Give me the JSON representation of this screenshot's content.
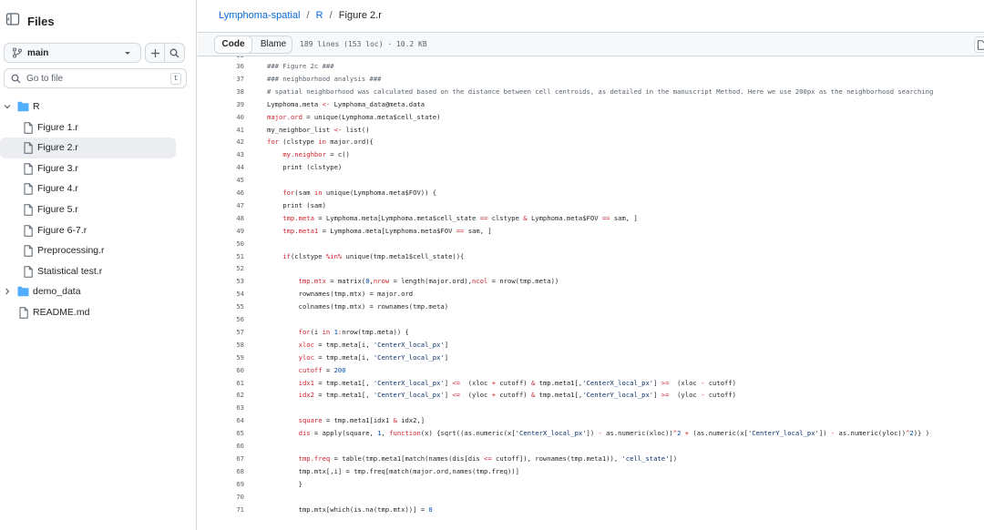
{
  "sidebar": {
    "title": "Files",
    "branch": "main",
    "search_placeholder": "Go to file",
    "search_shortcut": "t",
    "tree": [
      {
        "name": "R",
        "type": "folder",
        "open": true,
        "depth": 0
      },
      {
        "name": "Figure 1.r",
        "type": "file",
        "depth": 1
      },
      {
        "name": "Figure 2.r",
        "type": "file",
        "depth": 1,
        "selected": true
      },
      {
        "name": "Figure 3.r",
        "type": "file",
        "depth": 1
      },
      {
        "name": "Figure 4.r",
        "type": "file",
        "depth": 1
      },
      {
        "name": "Figure 5.r",
        "type": "file",
        "depth": 1
      },
      {
        "name": "Figure 6-7.r",
        "type": "file",
        "depth": 1
      },
      {
        "name": "Preprocessing.r",
        "type": "file",
        "depth": 1
      },
      {
        "name": "Statistical test.r",
        "type": "file",
        "depth": 1
      },
      {
        "name": "demo_data",
        "type": "folder",
        "open": false,
        "depth": 0
      },
      {
        "name": "README.md",
        "type": "file",
        "depth": 0
      }
    ]
  },
  "breadcrumb": {
    "repo": "Lymphoma-spatial",
    "sep1": "/",
    "folder": "R",
    "sep2": "/",
    "file": "Figure 2.r"
  },
  "filebar": {
    "code_tab": "Code",
    "blame_tab": "Blame",
    "info": "189 lines (153 loc) · 10.2 KB"
  },
  "colors": {
    "link": "#0969da",
    "keyword": "#cf222e",
    "string": "#0a3069",
    "number": "#0550ae",
    "comment": "#59636e",
    "folder": "#54aeff"
  },
  "code": {
    "first_partial_line": "35",
    "lines": [
      {
        "n": "36",
        "t": [
          [
            "c",
            "### Figure 2c ###"
          ]
        ]
      },
      {
        "n": "37",
        "t": [
          [
            "c",
            "### neighborhood analysis ###"
          ]
        ]
      },
      {
        "n": "38",
        "t": [
          [
            "c",
            "# spatial neighborhood was calculated based on the distance between cell centroids, as detailed in the manuscript Method. Here we use 200px as the neighborhood searching"
          ]
        ]
      },
      {
        "n": "39",
        "t": [
          [
            "p",
            "Lymphoma.meta "
          ],
          [
            "k",
            "<-"
          ],
          [
            "p",
            " Lymphoma_data@meta.data"
          ]
        ]
      },
      {
        "n": "40",
        "t": [
          [
            "k",
            "major.ord"
          ],
          [
            "p",
            " = unique(Lymphoma.meta$cell_state)"
          ]
        ]
      },
      {
        "n": "41",
        "t": [
          [
            "p",
            "my_neighbor_list "
          ],
          [
            "k",
            "<-"
          ],
          [
            "p",
            " list()"
          ]
        ]
      },
      {
        "n": "42",
        "t": [
          [
            "k",
            "for"
          ],
          [
            "p",
            " (clstype "
          ],
          [
            "k",
            "in"
          ],
          [
            "p",
            " major.ord){"
          ]
        ]
      },
      {
        "n": "43",
        "t": [
          [
            "p",
            "    "
          ],
          [
            "k",
            "my.neighbor"
          ],
          [
            "p",
            " = c()"
          ]
        ]
      },
      {
        "n": "44",
        "t": [
          [
            "p",
            "    print (clstype)"
          ]
        ]
      },
      {
        "n": "45",
        "t": [
          [
            "p",
            ""
          ]
        ]
      },
      {
        "n": "46",
        "t": [
          [
            "p",
            "    "
          ],
          [
            "k",
            "for"
          ],
          [
            "p",
            "(sam "
          ],
          [
            "k",
            "in"
          ],
          [
            "p",
            " unique(Lymphoma.meta$FOV)) {"
          ]
        ]
      },
      {
        "n": "47",
        "t": [
          [
            "p",
            "    print (sam)"
          ]
        ]
      },
      {
        "n": "48",
        "t": [
          [
            "p",
            "    "
          ],
          [
            "k",
            "tmp.meta"
          ],
          [
            "p",
            " = Lymphoma.meta[Lymphoma.meta$cell_state "
          ],
          [
            "k",
            "=="
          ],
          [
            "p",
            " clstype "
          ],
          [
            "k",
            "&"
          ],
          [
            "p",
            " Lymphoma.meta$FOV "
          ],
          [
            "k",
            "=="
          ],
          [
            "p",
            " sam, ]"
          ]
        ]
      },
      {
        "n": "49",
        "t": [
          [
            "p",
            "    "
          ],
          [
            "k",
            "tmp.meta1"
          ],
          [
            "p",
            " = Lymphoma.meta[Lymphoma.meta$FOV "
          ],
          [
            "k",
            "=="
          ],
          [
            "p",
            " sam, ]"
          ]
        ]
      },
      {
        "n": "50",
        "t": [
          [
            "p",
            ""
          ]
        ]
      },
      {
        "n": "51",
        "t": [
          [
            "p",
            "    "
          ],
          [
            "k",
            "if"
          ],
          [
            "p",
            "(clstype "
          ],
          [
            "k",
            "%in%"
          ],
          [
            "p",
            " unique(tmp.meta1$cell_state)){"
          ]
        ]
      },
      {
        "n": "52",
        "t": [
          [
            "p",
            ""
          ]
        ]
      },
      {
        "n": "53",
        "t": [
          [
            "p",
            "        "
          ],
          [
            "k",
            "tmp.mtx"
          ],
          [
            "p",
            " = matrix("
          ],
          [
            "n",
            "0"
          ],
          [
            "p",
            ","
          ],
          [
            "k",
            "nrow"
          ],
          [
            "p",
            " = length(major.ord),"
          ],
          [
            "k",
            "ncol"
          ],
          [
            "p",
            " = nrow(tmp.meta))"
          ]
        ]
      },
      {
        "n": "54",
        "t": [
          [
            "p",
            "        rownames(tmp.mtx) = major.ord"
          ]
        ]
      },
      {
        "n": "55",
        "t": [
          [
            "p",
            "        colnames(tmp.mtx) = rownames(tmp.meta)"
          ]
        ]
      },
      {
        "n": "56",
        "t": [
          [
            "p",
            ""
          ]
        ]
      },
      {
        "n": "57",
        "t": [
          [
            "p",
            "        "
          ],
          [
            "k",
            "for"
          ],
          [
            "p",
            "(i "
          ],
          [
            "k",
            "in"
          ],
          [
            "p",
            " "
          ],
          [
            "n",
            "1"
          ],
          [
            "k",
            ":"
          ],
          [
            "p",
            "nrow(tmp.meta)) {"
          ]
        ]
      },
      {
        "n": "58",
        "t": [
          [
            "p",
            "        "
          ],
          [
            "k",
            "xloc"
          ],
          [
            "p",
            " = tmp.meta[i, "
          ],
          [
            "s",
            "'CenterX_local_px'"
          ],
          [
            "p",
            "]"
          ]
        ]
      },
      {
        "n": "59",
        "t": [
          [
            "p",
            "        "
          ],
          [
            "k",
            "yloc"
          ],
          [
            "p",
            " = tmp.meta[i, "
          ],
          [
            "s",
            "'CenterY_local_px'"
          ],
          [
            "p",
            "]"
          ]
        ]
      },
      {
        "n": "60",
        "t": [
          [
            "p",
            "        "
          ],
          [
            "k",
            "cutoff"
          ],
          [
            "p",
            " = "
          ],
          [
            "n",
            "200"
          ]
        ]
      },
      {
        "n": "61",
        "t": [
          [
            "p",
            "        "
          ],
          [
            "k",
            "idx1"
          ],
          [
            "p",
            " = tmp.meta1[, "
          ],
          [
            "s",
            "'CenterX_local_px'"
          ],
          [
            "p",
            "] "
          ],
          [
            "k",
            "<="
          ],
          [
            "p",
            "  (xloc "
          ],
          [
            "k",
            "+"
          ],
          [
            "p",
            " cutoff) "
          ],
          [
            "k",
            "&"
          ],
          [
            "p",
            " tmp.meta1[,"
          ],
          [
            "s",
            "'CenterX_local_px'"
          ],
          [
            "p",
            "] "
          ],
          [
            "k",
            ">="
          ],
          [
            "p",
            "  (xloc "
          ],
          [
            "k",
            "-"
          ],
          [
            "p",
            " cutoff)"
          ]
        ]
      },
      {
        "n": "62",
        "t": [
          [
            "p",
            "        "
          ],
          [
            "k",
            "idx2"
          ],
          [
            "p",
            " = tmp.meta1[, "
          ],
          [
            "s",
            "'CenterY_local_px'"
          ],
          [
            "p",
            "] "
          ],
          [
            "k",
            "<="
          ],
          [
            "p",
            "  (yloc "
          ],
          [
            "k",
            "+"
          ],
          [
            "p",
            " cutoff) "
          ],
          [
            "k",
            "&"
          ],
          [
            "p",
            " tmp.meta1[,"
          ],
          [
            "s",
            "'CenterY_local_px'"
          ],
          [
            "p",
            "] "
          ],
          [
            "k",
            ">="
          ],
          [
            "p",
            "  (yloc "
          ],
          [
            "k",
            "-"
          ],
          [
            "p",
            " cutoff)"
          ]
        ]
      },
      {
        "n": "63",
        "t": [
          [
            "p",
            ""
          ]
        ]
      },
      {
        "n": "64",
        "t": [
          [
            "p",
            "        "
          ],
          [
            "k",
            "square"
          ],
          [
            "p",
            " = tmp.meta1[idx1 "
          ],
          [
            "k",
            "&"
          ],
          [
            "p",
            " idx2,]"
          ]
        ]
      },
      {
        "n": "65",
        "t": [
          [
            "p",
            "        "
          ],
          [
            "k",
            "dis"
          ],
          [
            "p",
            " = apply(square, "
          ],
          [
            "n",
            "1"
          ],
          [
            "p",
            ", "
          ],
          [
            "k",
            "function"
          ],
          [
            "p",
            "(x) {sqrt((as.numeric(x["
          ],
          [
            "s",
            "'CenterX_local_px'"
          ],
          [
            "p",
            "]) "
          ],
          [
            "k",
            "-"
          ],
          [
            "p",
            " as.numeric(xloc))"
          ],
          [
            "k",
            "^"
          ],
          [
            "n",
            "2"
          ],
          [
            "p",
            " "
          ],
          [
            "k",
            "+"
          ],
          [
            "p",
            " (as.numeric(x["
          ],
          [
            "s",
            "'CenterY_local_px'"
          ],
          [
            "p",
            "]) "
          ],
          [
            "k",
            "-"
          ],
          [
            "p",
            " as.numeric(yloc))"
          ],
          [
            "k",
            "^"
          ],
          [
            "n",
            "2"
          ],
          [
            "p",
            ")} )"
          ]
        ]
      },
      {
        "n": "66",
        "t": [
          [
            "p",
            ""
          ]
        ]
      },
      {
        "n": "67",
        "t": [
          [
            "p",
            "        "
          ],
          [
            "k",
            "tmp.freq"
          ],
          [
            "p",
            " = table(tmp.meta1[match(names(dis[dis "
          ],
          [
            "k",
            "<="
          ],
          [
            "p",
            " cutoff]), rownames(tmp.meta1)), "
          ],
          [
            "s",
            "'cell_state'"
          ],
          [
            "p",
            "])"
          ]
        ]
      },
      {
        "n": "68",
        "t": [
          [
            "p",
            "        tmp.mtx[,i] = tmp.freq[match(major.ord,names(tmp.freq))]"
          ]
        ]
      },
      {
        "n": "69",
        "t": [
          [
            "p",
            "        }"
          ]
        ]
      },
      {
        "n": "70",
        "t": [
          [
            "p",
            ""
          ]
        ]
      },
      {
        "n": "71",
        "t": [
          [
            "p",
            "        tmp.mtx[which(is.na(tmp.mtx))] = "
          ],
          [
            "n",
            "0"
          ]
        ]
      }
    ]
  }
}
